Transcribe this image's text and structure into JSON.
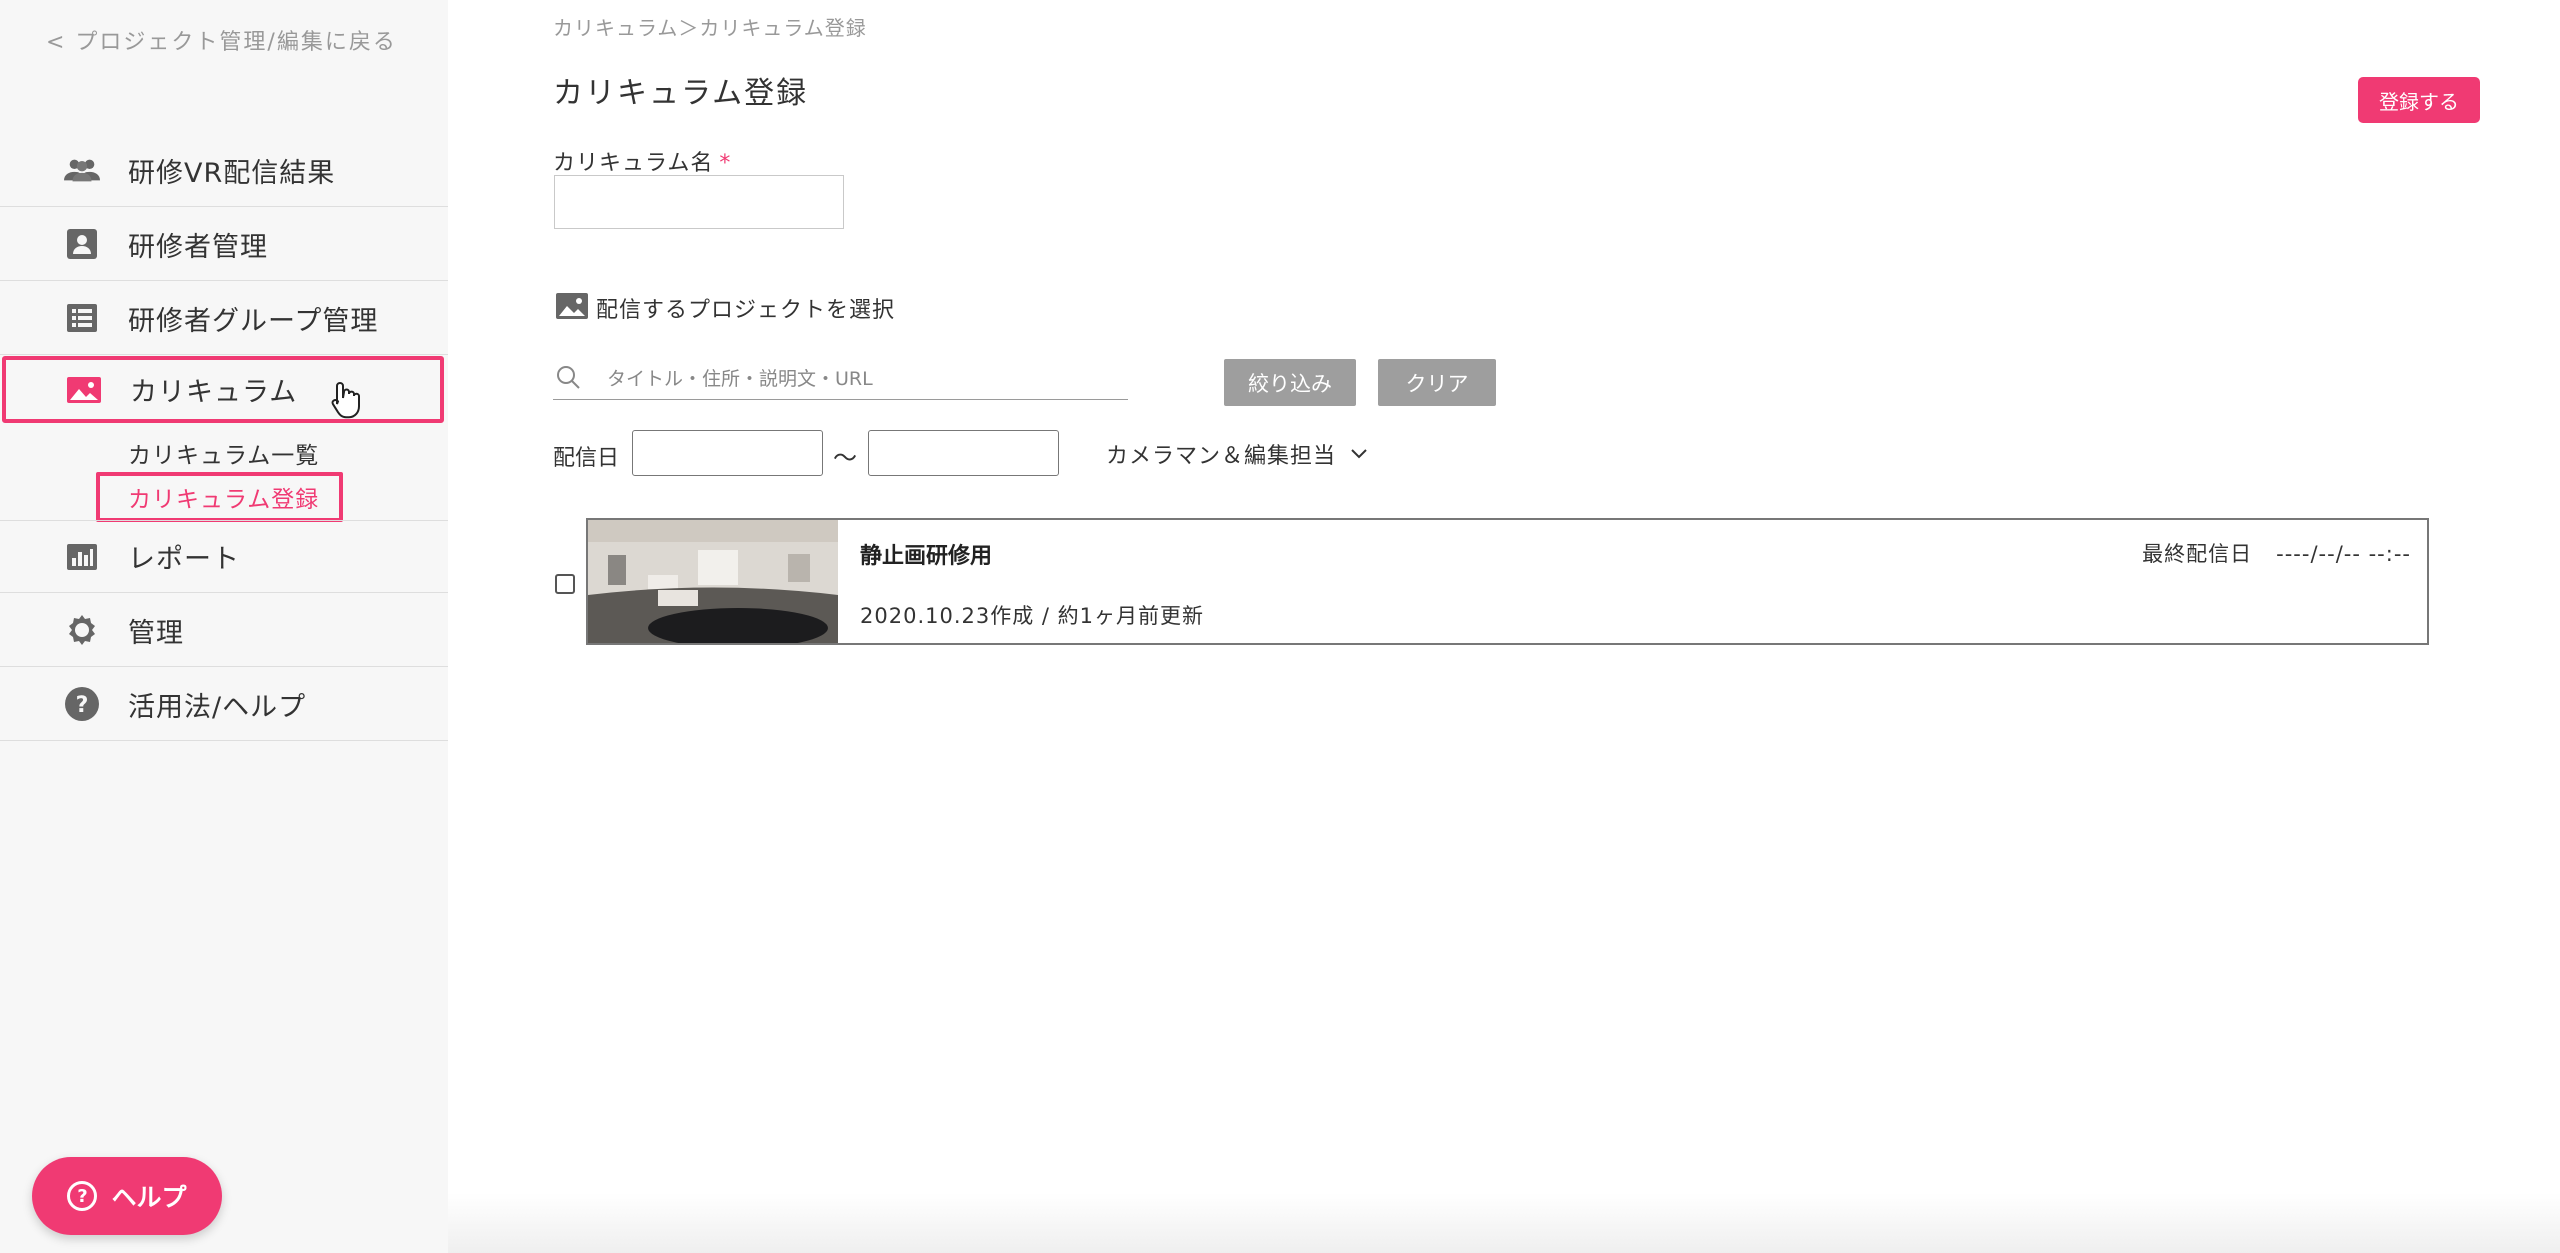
{
  "sidebar": {
    "back_link": "< プロジェクト管理/編集に戻る",
    "items": [
      {
        "label": "研修VR配信結果",
        "icon": "people-icon"
      },
      {
        "label": "研修者管理",
        "icon": "person-card-icon"
      },
      {
        "label": "研修者グループ管理",
        "icon": "list-icon"
      },
      {
        "label": "カリキュラム",
        "icon": "image-icon"
      },
      {
        "label": "レポート",
        "icon": "bar-chart-icon"
      },
      {
        "label": "管理",
        "icon": "gear-icon"
      },
      {
        "label": "活用法/ヘルプ",
        "icon": "help-circle-icon"
      }
    ],
    "sub_items": [
      "カリキュラム一覧",
      "カリキュラム登録"
    ],
    "help_button": "ヘルプ"
  },
  "main": {
    "breadcrumb": "カリキュラム＞カリキュラム登録",
    "title": "カリキュラム登録",
    "register_button": "登録する",
    "name_field_label": "カリキュラム名",
    "required_mark": "*",
    "name_value": "",
    "section_label": "配信するプロジェクトを選択",
    "search_placeholder": "タイトル・住所・説明文・URL",
    "filter_button": "絞り込み",
    "clear_button": "クリア",
    "date_label": "配信日",
    "date_separator": "〜",
    "dropdown_label": "カメラマン＆編集担当",
    "projects": [
      {
        "title": "静止画研修用",
        "meta": "2020.10.23作成 / 約1ヶ月前更新",
        "last_delivery_label": "最終配信日",
        "last_delivery_value": "----/--/-- --:--"
      }
    ]
  },
  "colors": {
    "accent": "#f03a73",
    "button_gray": "#9e9e9e",
    "sidebar_bg": "#f7f7f7"
  }
}
